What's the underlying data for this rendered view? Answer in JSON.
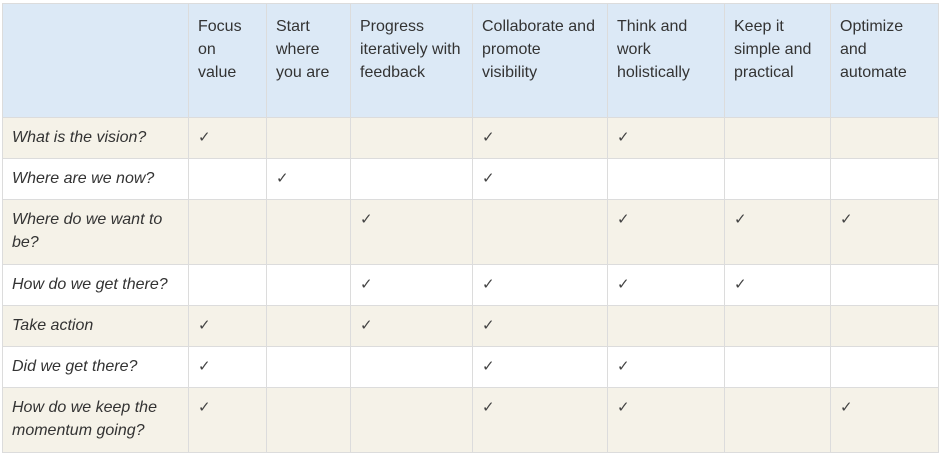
{
  "table": {
    "headers": [
      "",
      "Focus on value",
      "Start where you are",
      "Progress iteratively with feedback",
      "Collaborate and promote visibility",
      "Think and work holistically",
      "Keep it simple and practical",
      "Optimize and automate"
    ],
    "check_mark": "✓",
    "rows": [
      {
        "question": "What is the vision?",
        "checks": [
          true,
          false,
          false,
          true,
          true,
          false,
          false
        ]
      },
      {
        "question": "Where are we now?",
        "checks": [
          false,
          true,
          false,
          true,
          false,
          false,
          false
        ]
      },
      {
        "question": "Where do we want to be?",
        "checks": [
          false,
          false,
          true,
          false,
          true,
          true,
          true
        ]
      },
      {
        "question": "How do we get there?",
        "checks": [
          false,
          false,
          true,
          true,
          true,
          true,
          false
        ]
      },
      {
        "question": "Take action",
        "checks": [
          true,
          false,
          true,
          true,
          false,
          false,
          false
        ]
      },
      {
        "question": "Did we get there?",
        "checks": [
          true,
          false,
          false,
          true,
          true,
          false,
          false
        ]
      },
      {
        "question": "How do we keep the momentum going?",
        "checks": [
          true,
          false,
          false,
          true,
          true,
          false,
          true
        ]
      }
    ]
  },
  "colors": {
    "header_bg": "#dce9f6",
    "row_alt_bg": "#f5f2e8",
    "row_bg": "#ffffff",
    "border": "#dcdcdc",
    "text": "#333333"
  }
}
